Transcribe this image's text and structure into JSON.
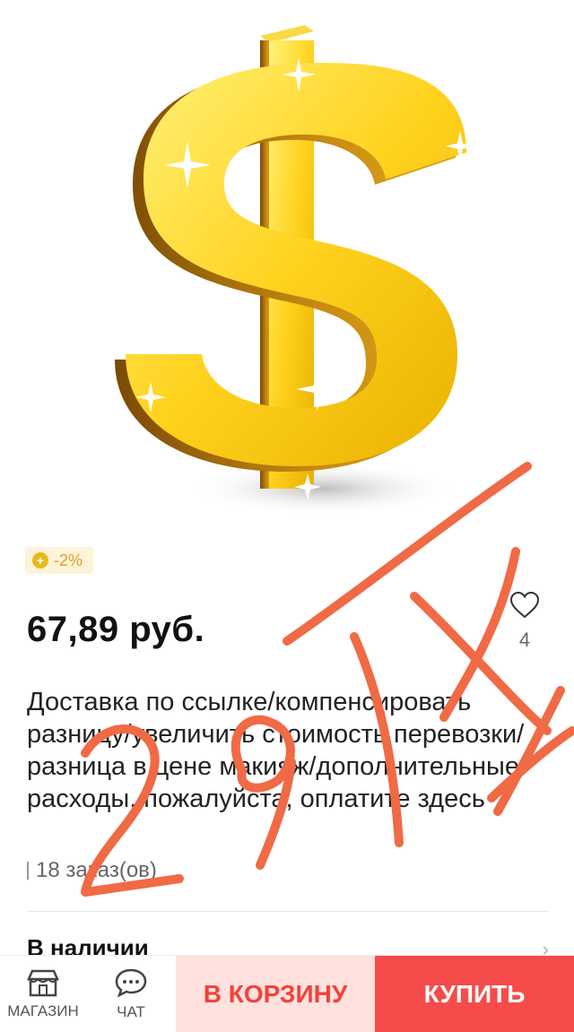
{
  "product": {
    "image_icon": "gold-dollar-sign",
    "coupon": {
      "icon": "coin-icon",
      "icon_glyph": "+",
      "text": "-2%"
    },
    "price": "67,89 руб.",
    "wishlist": {
      "icon": "heart-icon",
      "count": "4"
    },
    "title": "Доставка по ссылке/компенсировать разницу/увеличить стоимость перевозки/разница в цене макияж/дополнительные расходы, пожалуйста, оплатите здесь",
    "orders": "18 заказ(ов)",
    "stock": "В наличии"
  },
  "bottom_bar": {
    "store_label": "МАГАЗИН",
    "chat_label": "ЧАТ",
    "cart_label": "В КОРЗИНУ",
    "buy_label": "КУПИТЬ"
  },
  "colors": {
    "accent": "#f64b4b",
    "cart_bg": "#ffe1dd",
    "coupon_bg": "#fdf3d8",
    "coupon_text": "#d8a12b",
    "scribble": "#f06a45"
  }
}
